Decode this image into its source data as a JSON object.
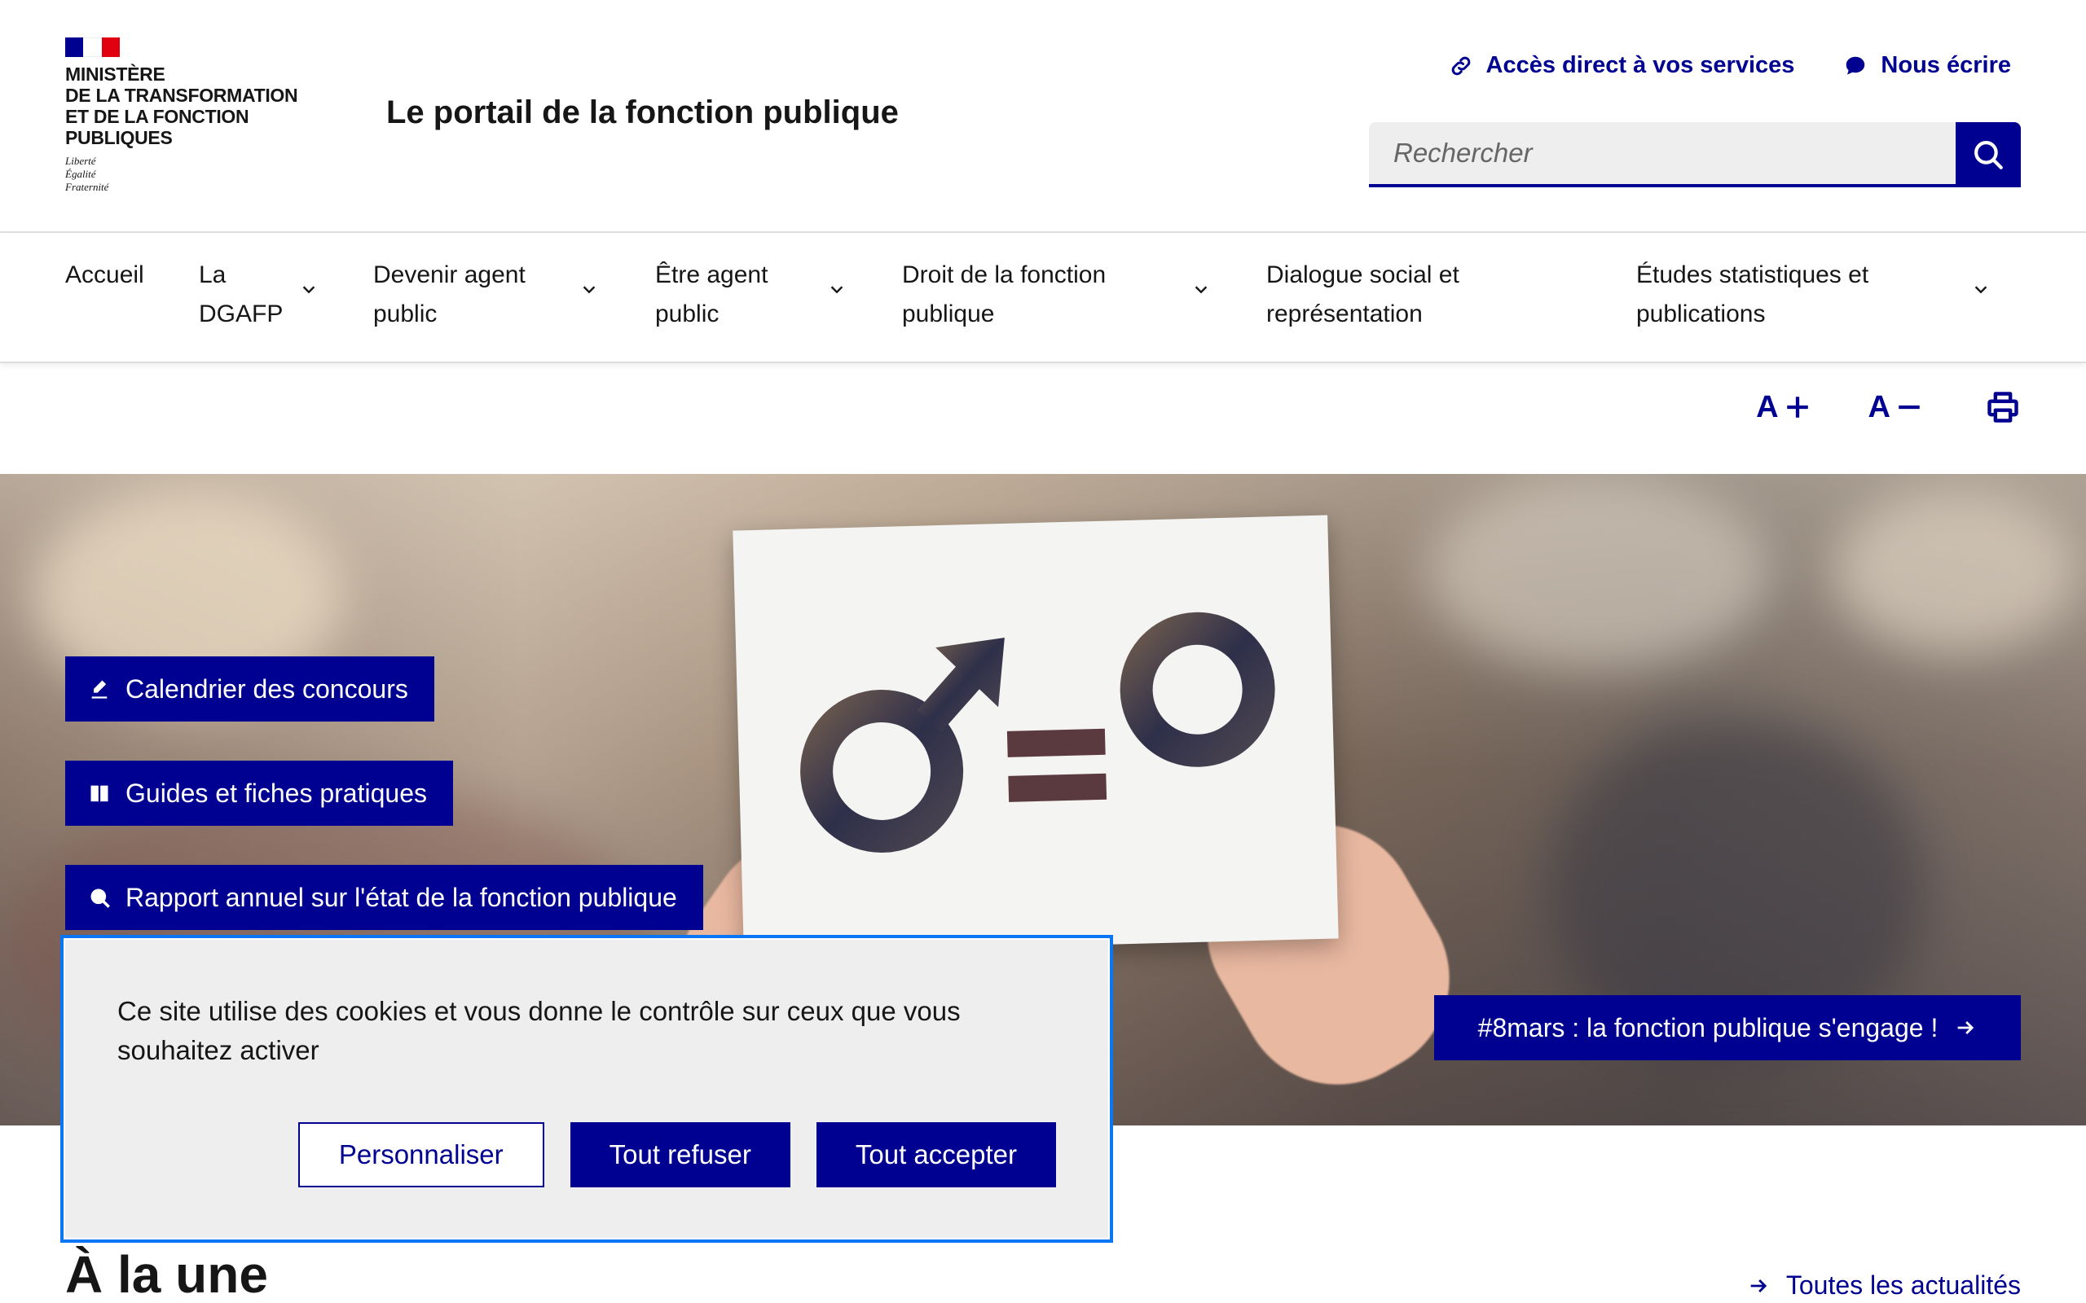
{
  "header": {
    "ministry_name": "MINISTÈRE\nDE LA TRANSFORMATION\nET DE LA FONCTION\nPUBLIQUES",
    "motto": "Liberté\nÉgalité\nFraternité",
    "site_title": "Le portail de la fonction publique",
    "tools": {
      "services_label": "Accès direct à vos services",
      "contact_label": "Nous écrire"
    },
    "search": {
      "placeholder": "Rechercher"
    }
  },
  "nav": {
    "items": [
      {
        "label": "Accueil"
      },
      {
        "label": "La\nDGAFP"
      },
      {
        "label": "Devenir agent\npublic"
      },
      {
        "label": "Être agent\npublic"
      },
      {
        "label": "Droit de la fonction\npublique"
      },
      {
        "label": "Dialogue social et\nreprésentation"
      },
      {
        "label": "Études statistiques et\npublications"
      }
    ]
  },
  "utility": {
    "increase_font": "A",
    "decrease_font": "A"
  },
  "hero": {
    "quick_links": [
      {
        "label": "Calendrier des concours"
      },
      {
        "label": "Guides et fiches pratiques"
      },
      {
        "label": "Rapport annuel sur l'état de la fonction publique"
      }
    ],
    "news_button": "#8mars : la fonction publique s'engage !"
  },
  "section": {
    "title": "À la une",
    "all_news": "Toutes les actualités"
  },
  "cookie": {
    "text": "Ce site utilise des cookies et vous donne le contrôle sur ceux que vous souhaitez activer",
    "customize": "Personnaliser",
    "refuse_all": "Tout refuser",
    "accept_all": "Tout accepter"
  },
  "colors": {
    "primary": "#000091",
    "flag_blue": "#000091",
    "flag_white": "#ffffff",
    "flag_red": "#e1000f",
    "focus_outline": "#0a76f6"
  }
}
